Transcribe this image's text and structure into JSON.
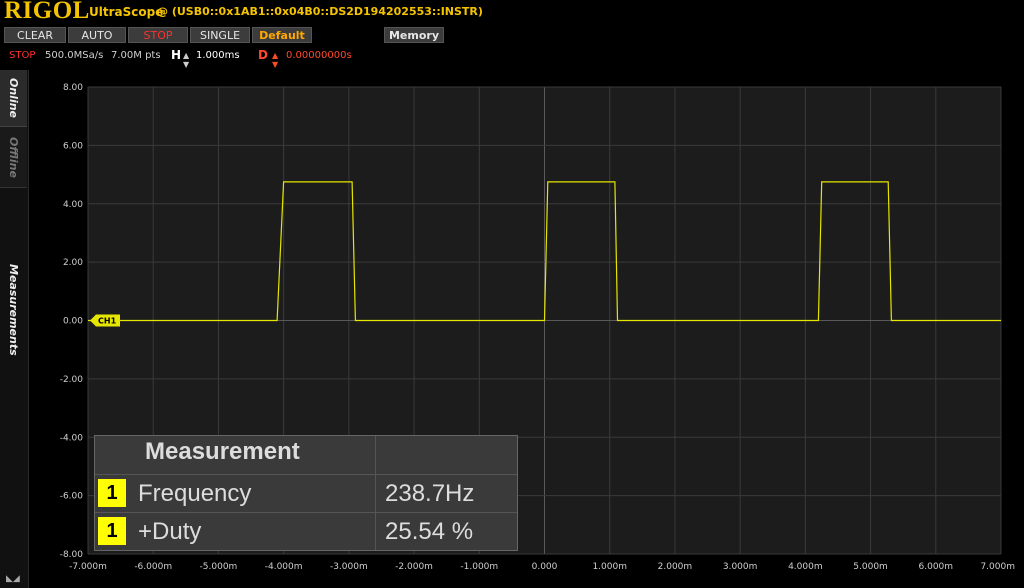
{
  "header": {
    "logo": "RIGOL",
    "app_name": "UltraScope",
    "connection": "@ (USB0::0x1AB1::0x04B0::DS2D194202553::INSTR)"
  },
  "toolbar": {
    "clear_label": "CLEAR",
    "auto_label": "AUTO",
    "stop_label": "STOP",
    "single_label": "SINGLE",
    "default_label": "Default",
    "memory_label": "Memory"
  },
  "status": {
    "run_state": "STOP",
    "sample_rate": "500.0MSa/s",
    "memory_depth": "7.00M pts",
    "h_label": "H",
    "h_scale": "1.000ms",
    "d_label": "D",
    "d_offset": "0.00000000s"
  },
  "sidebar": {
    "tabs": [
      "Online",
      "Offline",
      "Measurements"
    ]
  },
  "scope": {
    "channel_marker": "CH1",
    "trace_color": "#e6e600",
    "grid_color": "#3a3a3a",
    "background": "#1c1c1c"
  },
  "chart_data": {
    "type": "line",
    "xlim": [
      -7.0,
      7.0
    ],
    "ylim": [
      -8.0,
      8.0
    ],
    "x_tick_labels": [
      "-7.000m",
      "-6.000m",
      "-5.000m",
      "-4.000m",
      "-3.000m",
      "-2.000m",
      "-1.000m",
      "0.000",
      "1.000m",
      "2.000m",
      "3.000m",
      "4.000m",
      "5.000m",
      "6.000m",
      "7.000m"
    ],
    "y_tick_labels": [
      "8.00",
      "6.00",
      "4.00",
      "2.00",
      "0.00",
      "-2.00",
      "-4.00",
      "-6.00",
      "-8.00"
    ],
    "grid": true,
    "series": [
      {
        "x": [
          -7.0,
          -4.1,
          -4.0,
          -2.95,
          -2.9,
          0.0,
          0.05,
          1.08,
          1.12,
          4.2,
          4.25,
          5.27,
          5.32,
          7.0
        ],
        "y": [
          0.0,
          0.0,
          4.75,
          4.75,
          0.0,
          0.0,
          4.75,
          4.75,
          0.0,
          0.0,
          4.75,
          4.75,
          0.0,
          0.0
        ]
      }
    ]
  },
  "measurements": {
    "header": "Measurement",
    "rows": [
      {
        "channel": "1",
        "name": "Frequency",
        "value": "238.7Hz"
      },
      {
        "channel": "1",
        "name": "+Duty",
        "value": "25.54 %"
      }
    ]
  }
}
